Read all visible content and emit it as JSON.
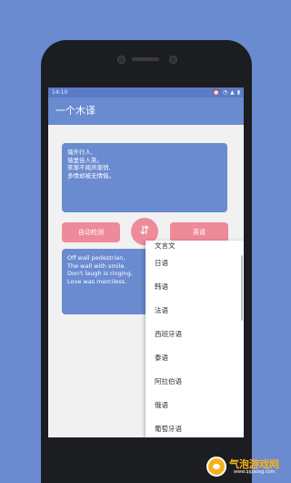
{
  "status_bar": {
    "time": "14:10",
    "icons": [
      "alarm-icon",
      "wifi-icon",
      "signal-icon",
      "battery-icon"
    ]
  },
  "app_bar": {
    "title": "一个木译"
  },
  "source_card": {
    "lines": [
      "墙外行人,",
      "墙里佳人笑。",
      "笑渐不闻声渐悄,",
      "多情却被无情恼。"
    ]
  },
  "controls": {
    "source_lang": "自动检测",
    "target_lang": "英语",
    "swap_icon": "swap-icon"
  },
  "output_card": {
    "lines": [
      "Off wall pedestrian,",
      "The wall with smile.",
      "Don't laugh is ringing,",
      "Love was merciless."
    ]
  },
  "language_menu": {
    "items": [
      "文言文",
      "日语",
      "韩语",
      "法语",
      "西班牙语",
      "泰语",
      "阿拉伯语",
      "俄语",
      "葡萄牙语"
    ]
  },
  "watermark": {
    "title": "气泡游戏网",
    "url": "www.qipaoxg.com"
  }
}
